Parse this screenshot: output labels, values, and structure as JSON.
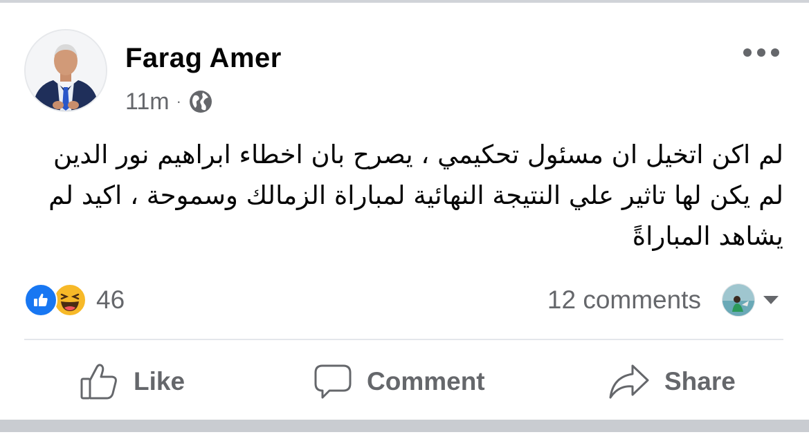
{
  "post": {
    "author": "Farag Amer",
    "time": "11m",
    "separator": "·",
    "privacy_icon": "globe-icon",
    "more_icon": "more-horizontal-icon",
    "text": "لم اكن اتخيل ان مسئول تحكيمي ، يصرح بان اخطاء ابراهيم نور الدين لم يكن لها تاثير علي النتيجة النهائية لمباراة الزمالك وسموحة ، اكيد لم يشاهد المباراةً"
  },
  "reactions": {
    "icons": [
      "like-reaction-icon",
      "haha-reaction-icon"
    ],
    "count": "46"
  },
  "comments": {
    "count_label": "12 comments"
  },
  "actions": {
    "like_label": "Like",
    "comment_label": "Comment",
    "share_label": "Share"
  },
  "colors": {
    "text_primary": "#050505",
    "text_secondary": "#65676b",
    "like_blue": "#1877f2",
    "haha_yellow": "#f7b928",
    "divider": "#e4e6eb"
  }
}
